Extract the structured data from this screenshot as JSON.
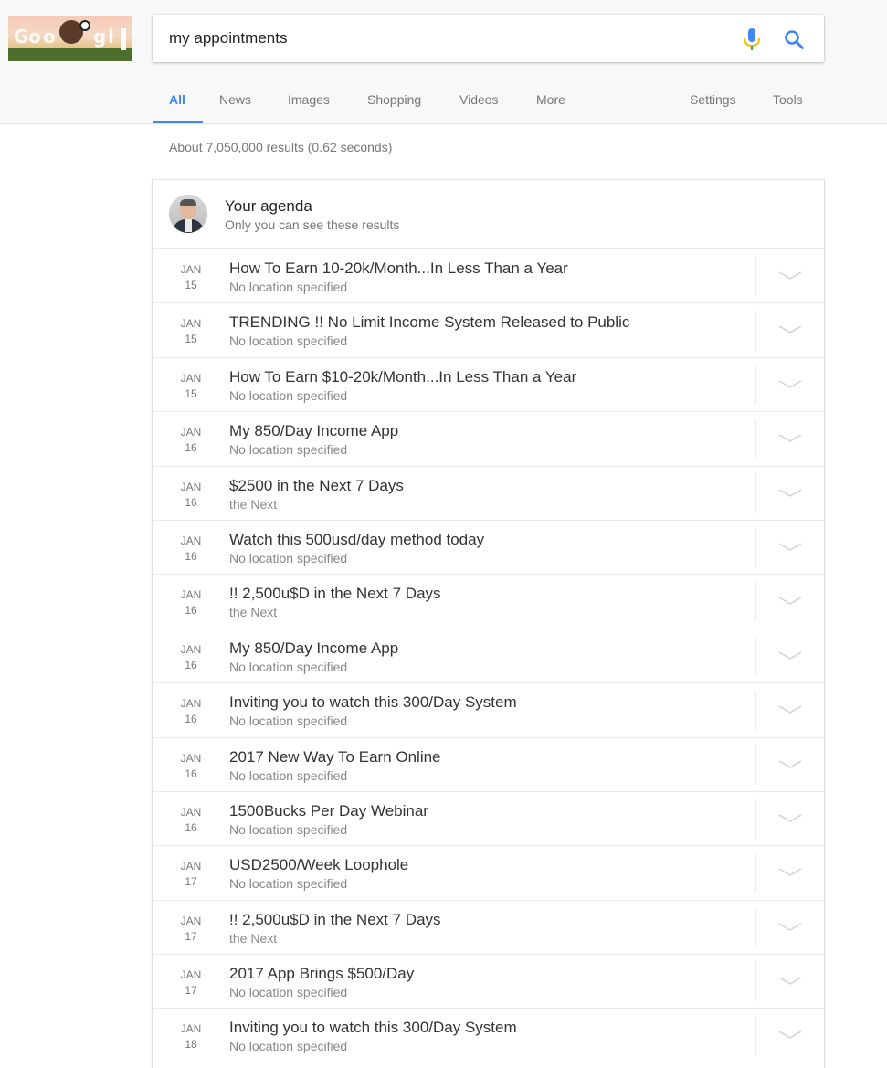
{
  "search": {
    "query": "my appointments"
  },
  "doodle": {
    "letters": [
      "G",
      "o",
      "o",
      "g",
      "l",
      "e"
    ]
  },
  "tabs": [
    {
      "label": "All"
    },
    {
      "label": "News"
    },
    {
      "label": "Images"
    },
    {
      "label": "Shopping"
    },
    {
      "label": "Videos"
    },
    {
      "label": "More"
    },
    {
      "label": "Settings"
    },
    {
      "label": "Tools"
    }
  ],
  "stats": "About 7,050,000 results (0.62 seconds)",
  "agenda": {
    "title": "Your agenda",
    "subtitle": "Only you can see these results",
    "events": [
      {
        "month": "JAN",
        "day": "15",
        "title": "How To Earn 10-20k/Month...In Less Than a Year",
        "location": "No location specified"
      },
      {
        "month": "JAN",
        "day": "15",
        "title": "TRENDING !! No Limit Income System Released to Public",
        "location": "No location specified"
      },
      {
        "month": "JAN",
        "day": "15",
        "title": "How To Earn $10-20k/Month...In Less Than a Year",
        "location": "No location specified"
      },
      {
        "month": "JAN",
        "day": "16",
        "title": "My 850/Day Income App",
        "location": "No location specified"
      },
      {
        "month": "JAN",
        "day": "16",
        "title": "$2500 in the Next 7 Days",
        "location": "the Next"
      },
      {
        "month": "JAN",
        "day": "16",
        "title": "Watch this 500usd/day method today",
        "location": "No location specified"
      },
      {
        "month": "JAN",
        "day": "16",
        "title": "!! 2,500u$D in the Next 7 Days",
        "location": "the Next"
      },
      {
        "month": "JAN",
        "day": "16",
        "title": "My 850/Day Income App",
        "location": "No location specified"
      },
      {
        "month": "JAN",
        "day": "16",
        "title": "Inviting you to watch this 300/Day System",
        "location": "No location specified"
      },
      {
        "month": "JAN",
        "day": "16",
        "title": "2017 New Way To Earn Online",
        "location": "No location specified"
      },
      {
        "month": "JAN",
        "day": "16",
        "title": "1500Bucks Per Day Webinar",
        "location": "No location specified"
      },
      {
        "month": "JAN",
        "day": "17",
        "title": "USD2500/Week Loophole",
        "location": "No location specified"
      },
      {
        "month": "JAN",
        "day": "17",
        "title": "!! 2,500u$D in the Next 7 Days",
        "location": "the Next"
      },
      {
        "month": "JAN",
        "day": "17",
        "title": "2017 App Brings $500/Day",
        "location": "No location specified"
      },
      {
        "month": "JAN",
        "day": "18",
        "title": "Inviting you to watch this 300/Day System",
        "location": "No location specified"
      }
    ]
  },
  "colors": {
    "accent": "#4285f4",
    "top_bar_bg": "#f8f8f8",
    "mic_blue": "#4285f4",
    "mic_red": "#ea4335",
    "mic_yellow": "#fbbc05",
    "mic_green": "#34a853"
  },
  "icons": {
    "mic": "microphone-icon",
    "search": "magnifier-icon",
    "expand": "chevron-down-icon"
  }
}
